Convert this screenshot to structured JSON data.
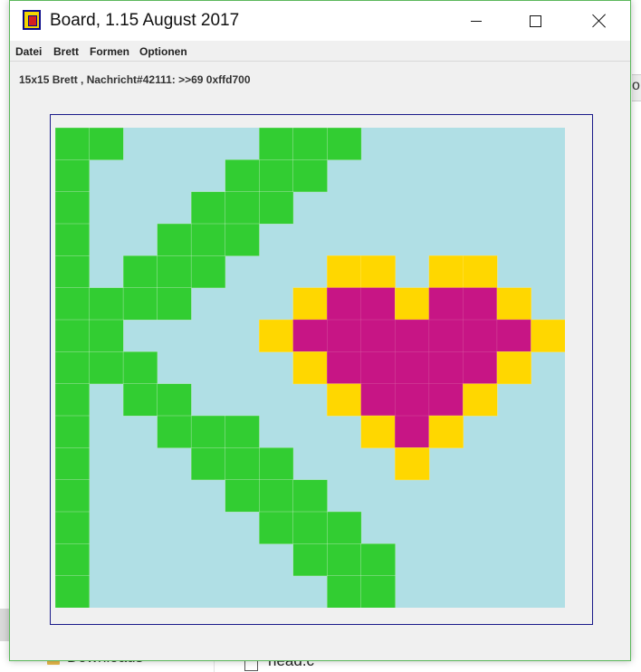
{
  "window": {
    "title": "Board, 1.15 August 2017",
    "icon": "board-app-icon",
    "controls": {
      "minimize": "minimize-icon",
      "maximize": "maximize-icon",
      "close": "close-icon"
    }
  },
  "menu": [
    "Datei",
    "Brett",
    "Formen",
    "Optionen"
  ],
  "status": "15x15 Brett , Nachricht#42111: >>69 0xffd700",
  "board": {
    "rows": 15,
    "cols": 15,
    "colors": {
      "background": "#b0dfe5",
      "green": "#32cd32",
      "yellow": "#ffd700",
      "magenta": "#c71585"
    },
    "grid": [
      "GG....GGG......",
      "G....GGG.......",
      "G...GGG........",
      "G..GGG.........",
      "G.GGG...YY.YY..",
      "GGGG...YMMYMMY.",
      "GG....YMMMMMMMY",
      "GGG....YMMMMMY.",
      "G.GG....YMMMY..",
      "G..GGG...YMY...",
      "G...GGG...Y....",
      "G....GGG.......",
      "G.....GGG......",
      "G......GGG.....",
      "G.......GG....."
    ]
  },
  "background": {
    "left_item": "Downloads",
    "right_item": "head.c",
    "edge_text": "o"
  }
}
